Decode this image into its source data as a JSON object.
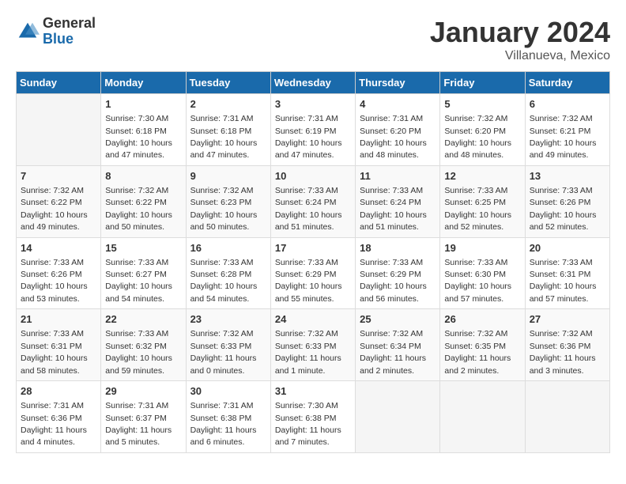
{
  "logo": {
    "general": "General",
    "blue": "Blue"
  },
  "header": {
    "title": "January 2024",
    "subtitle": "Villanueva, Mexico"
  },
  "days_of_week": [
    "Sunday",
    "Monday",
    "Tuesday",
    "Wednesday",
    "Thursday",
    "Friday",
    "Saturday"
  ],
  "weeks": [
    [
      {
        "day": "",
        "info": ""
      },
      {
        "day": "1",
        "info": "Sunrise: 7:30 AM\nSunset: 6:18 PM\nDaylight: 10 hours\nand 47 minutes."
      },
      {
        "day": "2",
        "info": "Sunrise: 7:31 AM\nSunset: 6:18 PM\nDaylight: 10 hours\nand 47 minutes."
      },
      {
        "day": "3",
        "info": "Sunrise: 7:31 AM\nSunset: 6:19 PM\nDaylight: 10 hours\nand 47 minutes."
      },
      {
        "day": "4",
        "info": "Sunrise: 7:31 AM\nSunset: 6:20 PM\nDaylight: 10 hours\nand 48 minutes."
      },
      {
        "day": "5",
        "info": "Sunrise: 7:32 AM\nSunset: 6:20 PM\nDaylight: 10 hours\nand 48 minutes."
      },
      {
        "day": "6",
        "info": "Sunrise: 7:32 AM\nSunset: 6:21 PM\nDaylight: 10 hours\nand 49 minutes."
      }
    ],
    [
      {
        "day": "7",
        "info": "Sunrise: 7:32 AM\nSunset: 6:22 PM\nDaylight: 10 hours\nand 49 minutes."
      },
      {
        "day": "8",
        "info": "Sunrise: 7:32 AM\nSunset: 6:22 PM\nDaylight: 10 hours\nand 50 minutes."
      },
      {
        "day": "9",
        "info": "Sunrise: 7:32 AM\nSunset: 6:23 PM\nDaylight: 10 hours\nand 50 minutes."
      },
      {
        "day": "10",
        "info": "Sunrise: 7:33 AM\nSunset: 6:24 PM\nDaylight: 10 hours\nand 51 minutes."
      },
      {
        "day": "11",
        "info": "Sunrise: 7:33 AM\nSunset: 6:24 PM\nDaylight: 10 hours\nand 51 minutes."
      },
      {
        "day": "12",
        "info": "Sunrise: 7:33 AM\nSunset: 6:25 PM\nDaylight: 10 hours\nand 52 minutes."
      },
      {
        "day": "13",
        "info": "Sunrise: 7:33 AM\nSunset: 6:26 PM\nDaylight: 10 hours\nand 52 minutes."
      }
    ],
    [
      {
        "day": "14",
        "info": "Sunrise: 7:33 AM\nSunset: 6:26 PM\nDaylight: 10 hours\nand 53 minutes."
      },
      {
        "day": "15",
        "info": "Sunrise: 7:33 AM\nSunset: 6:27 PM\nDaylight: 10 hours\nand 54 minutes."
      },
      {
        "day": "16",
        "info": "Sunrise: 7:33 AM\nSunset: 6:28 PM\nDaylight: 10 hours\nand 54 minutes."
      },
      {
        "day": "17",
        "info": "Sunrise: 7:33 AM\nSunset: 6:29 PM\nDaylight: 10 hours\nand 55 minutes."
      },
      {
        "day": "18",
        "info": "Sunrise: 7:33 AM\nSunset: 6:29 PM\nDaylight: 10 hours\nand 56 minutes."
      },
      {
        "day": "19",
        "info": "Sunrise: 7:33 AM\nSunset: 6:30 PM\nDaylight: 10 hours\nand 57 minutes."
      },
      {
        "day": "20",
        "info": "Sunrise: 7:33 AM\nSunset: 6:31 PM\nDaylight: 10 hours\nand 57 minutes."
      }
    ],
    [
      {
        "day": "21",
        "info": "Sunrise: 7:33 AM\nSunset: 6:31 PM\nDaylight: 10 hours\nand 58 minutes."
      },
      {
        "day": "22",
        "info": "Sunrise: 7:33 AM\nSunset: 6:32 PM\nDaylight: 10 hours\nand 59 minutes."
      },
      {
        "day": "23",
        "info": "Sunrise: 7:32 AM\nSunset: 6:33 PM\nDaylight: 11 hours\nand 0 minutes."
      },
      {
        "day": "24",
        "info": "Sunrise: 7:32 AM\nSunset: 6:33 PM\nDaylight: 11 hours\nand 1 minute."
      },
      {
        "day": "25",
        "info": "Sunrise: 7:32 AM\nSunset: 6:34 PM\nDaylight: 11 hours\nand 2 minutes."
      },
      {
        "day": "26",
        "info": "Sunrise: 7:32 AM\nSunset: 6:35 PM\nDaylight: 11 hours\nand 2 minutes."
      },
      {
        "day": "27",
        "info": "Sunrise: 7:32 AM\nSunset: 6:36 PM\nDaylight: 11 hours\nand 3 minutes."
      }
    ],
    [
      {
        "day": "28",
        "info": "Sunrise: 7:31 AM\nSunset: 6:36 PM\nDaylight: 11 hours\nand 4 minutes."
      },
      {
        "day": "29",
        "info": "Sunrise: 7:31 AM\nSunset: 6:37 PM\nDaylight: 11 hours\nand 5 minutes."
      },
      {
        "day": "30",
        "info": "Sunrise: 7:31 AM\nSunset: 6:38 PM\nDaylight: 11 hours\nand 6 minutes."
      },
      {
        "day": "31",
        "info": "Sunrise: 7:30 AM\nSunset: 6:38 PM\nDaylight: 11 hours\nand 7 minutes."
      },
      {
        "day": "",
        "info": ""
      },
      {
        "day": "",
        "info": ""
      },
      {
        "day": "",
        "info": ""
      }
    ]
  ]
}
